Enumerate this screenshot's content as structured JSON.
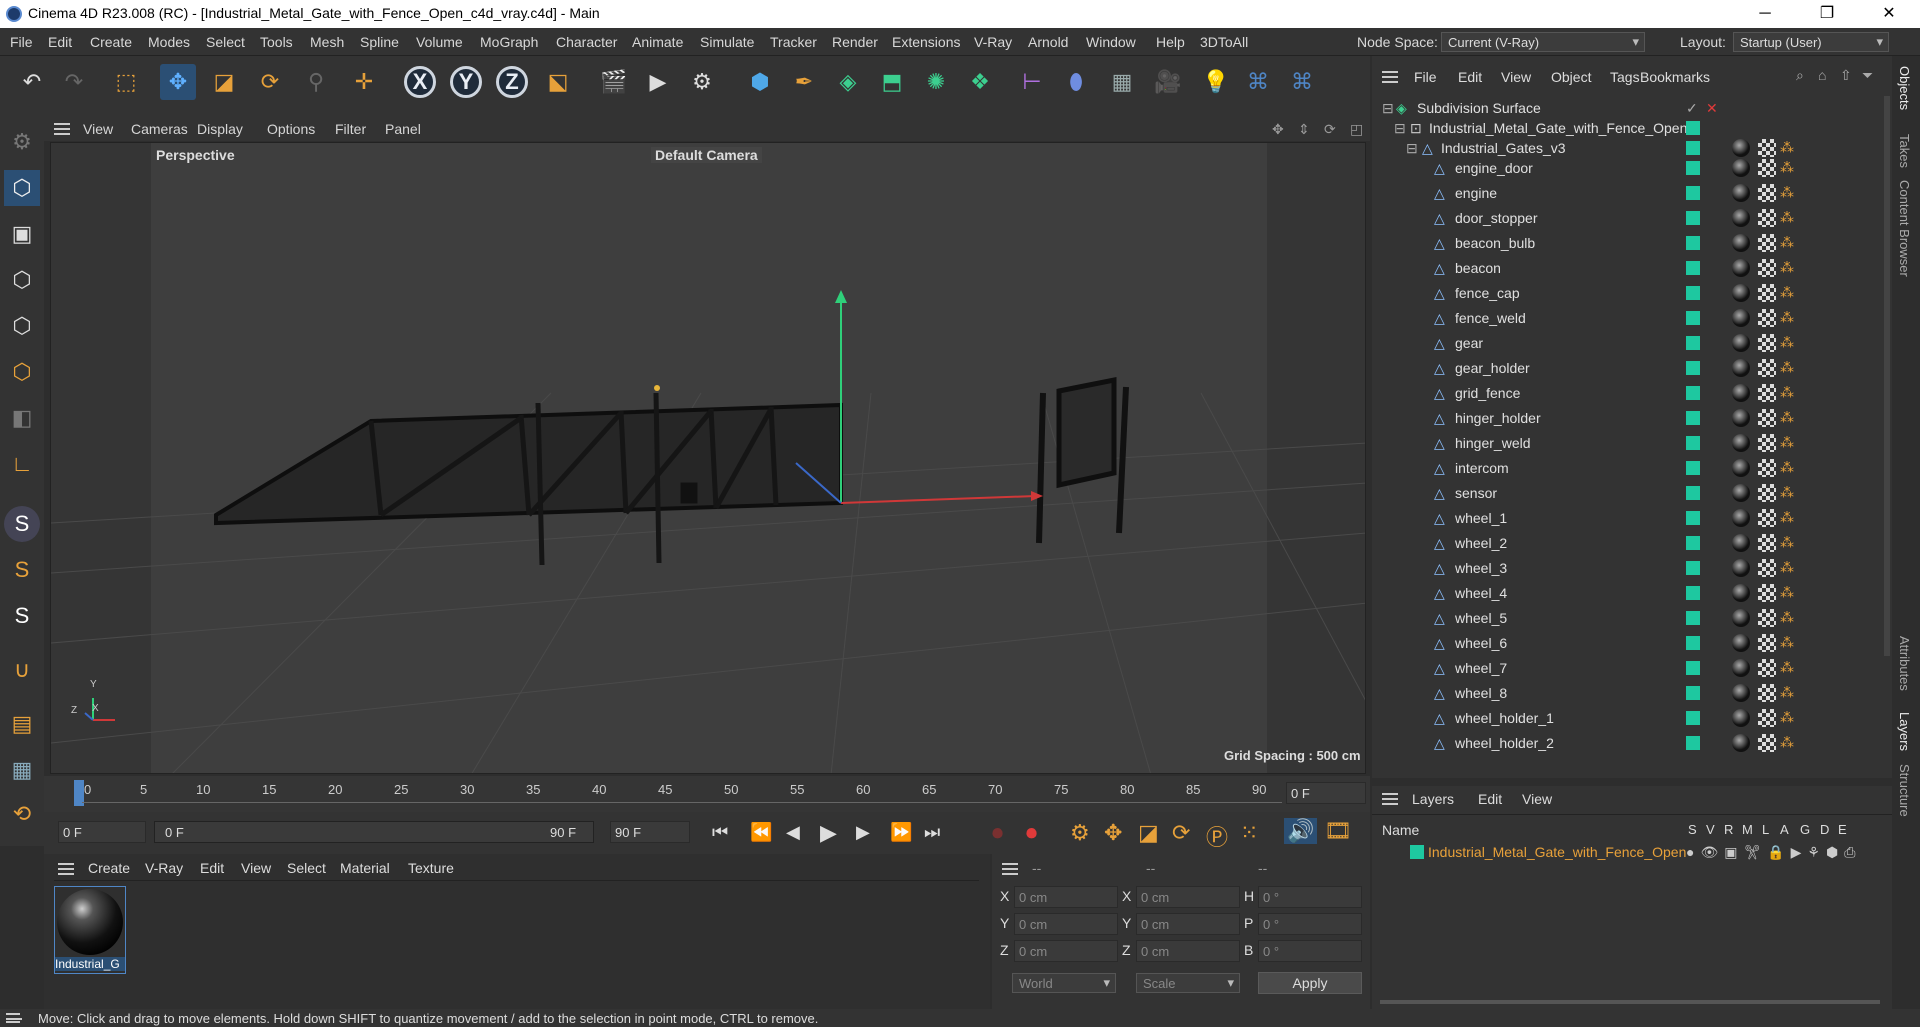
{
  "window": {
    "title": "Cinema 4D R23.008 (RC) - [Industrial_Metal_Gate_with_Fence_Open_c4d_vray.c4d] - Main",
    "minimize": "─",
    "maximize": "❐",
    "close": "✕"
  },
  "menu": {
    "items": [
      "File",
      "Edit",
      "Create",
      "Modes",
      "Select",
      "Tools",
      "Mesh",
      "Spline",
      "Volume",
      "MoGraph",
      "Character",
      "Animate",
      "Simulate",
      "Tracker",
      "Render",
      "Extensions",
      "V-Ray",
      "Arnold",
      "Window",
      "Help",
      "3DToAll"
    ],
    "node_space_label": "Node Space:",
    "node_space_value": "Current (V-Ray)",
    "layout_label": "Layout:",
    "layout_value": "Startup (User)"
  },
  "toolbar": {
    "axis_x": "X",
    "axis_y": "Y",
    "axis_z": "Z"
  },
  "viewport": {
    "menu": [
      "View",
      "Cameras",
      "Display",
      "Options",
      "Filter",
      "Panel"
    ],
    "view_name": "Perspective",
    "camera": "Default Camera",
    "grid_spacing": "Grid Spacing : 500 cm",
    "axis_x": "X",
    "axis_y": "Y",
    "axis_z": "Z"
  },
  "timeline": {
    "ticks": [
      "0",
      "5",
      "10",
      "15",
      "20",
      "25",
      "30",
      "35",
      "40",
      "45",
      "50",
      "55",
      "60",
      "65",
      "70",
      "75",
      "80",
      "85",
      "90"
    ],
    "current_frame": "0 F"
  },
  "transport": {
    "start": "0 F",
    "range_start": "0 F",
    "range_end": "90 F",
    "end": "90 F"
  },
  "material_panel": {
    "menu": [
      "Create",
      "V-Ray",
      "Edit",
      "View",
      "Select",
      "Material",
      "Texture"
    ],
    "material_name": "Industrial_G"
  },
  "coords": {
    "headers": [
      "--",
      "--",
      "--"
    ],
    "rows": [
      {
        "a": "X",
        "av": "0 cm",
        "b": "X",
        "bv": "0 cm",
        "c": "H",
        "cv": "0 °"
      },
      {
        "a": "Y",
        "av": "0 cm",
        "b": "Y",
        "bv": "0 cm",
        "c": "P",
        "cv": "0 °"
      },
      {
        "a": "Z",
        "av": "0 cm",
        "b": "Z",
        "bv": "0 cm",
        "c": "B",
        "cv": "0 °"
      }
    ],
    "space": "World",
    "mode": "Scale",
    "apply": "Apply"
  },
  "object_manager": {
    "menu": [
      "File",
      "Edit",
      "View",
      "Object",
      "Tags",
      "Bookmarks"
    ],
    "top": [
      "Subdivision Surface",
      "Industrial_Metal_Gate_with_Fence_Open",
      "Industrial_Gates_v3"
    ],
    "children": [
      "engine_door",
      "engine",
      "door_stopper",
      "beacon_bulb",
      "beacon",
      "fence_cap",
      "fence_weld",
      "gear",
      "gear_holder",
      "grid_fence",
      "hinger_holder",
      "hinger_weld",
      "intercom",
      "sensor",
      "wheel_1",
      "wheel_2",
      "wheel_3",
      "wheel_4",
      "wheel_5",
      "wheel_6",
      "wheel_7",
      "wheel_8",
      "wheel_holder_1",
      "wheel_holder_2"
    ]
  },
  "layer_manager": {
    "menu": [
      "Layers",
      "Edit",
      "View"
    ],
    "name_header": "Name",
    "cols": [
      "S",
      "V",
      "R",
      "M",
      "L",
      "A",
      "G",
      "D",
      "E"
    ],
    "layer_name": "Industrial_Metal_Gate_with_Fence_Open"
  },
  "right_tabs": [
    "Objects",
    "Takes",
    "Content Browser",
    "Attributes",
    "Layers",
    "Structure"
  ],
  "status": "Move: Click and drag to move elements. Hold down SHIFT to quantize movement / add to the selection in point mode, CTRL to remove.",
  "colors": {
    "accent": "#1ec8a0",
    "selected_blue": "#2b4f74",
    "layer_orange": "#e8a13a"
  }
}
